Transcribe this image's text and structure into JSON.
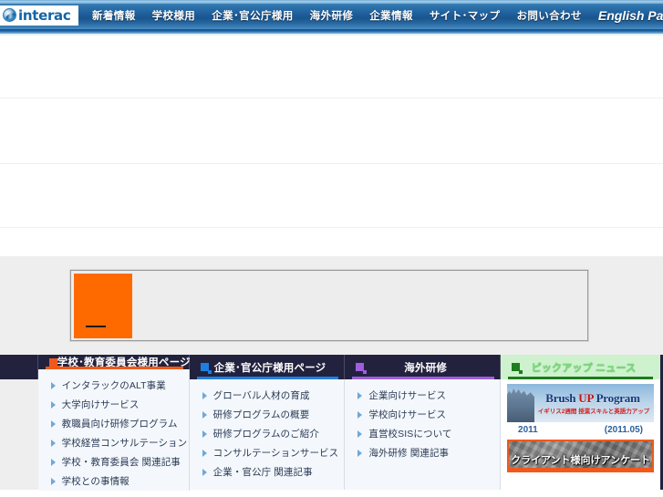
{
  "brand": {
    "logo_text": "interac",
    "logo_icon": "swirl-globe-icon"
  },
  "nav": {
    "items": [
      {
        "label": "新着情報",
        "name": "nav-news"
      },
      {
        "label": "学校様用",
        "name": "nav-schools"
      },
      {
        "label": "企業･官公庁様用",
        "name": "nav-corporate"
      },
      {
        "label": "海外研修",
        "name": "nav-overseas-training"
      },
      {
        "label": "企業情報",
        "name": "nav-company-info"
      },
      {
        "label": "サイト･マップ",
        "name": "nav-sitemap"
      },
      {
        "label": "お問い合わせ",
        "name": "nav-contact"
      },
      {
        "label": "English Page",
        "name": "nav-english-page"
      }
    ]
  },
  "banner": {
    "placeholder_color": "#ff6a00",
    "frame_name": "main-banner-frame"
  },
  "footer": {
    "columns": [
      {
        "title": "学校･教育委員会様用ページ",
        "accent": "#f0591b",
        "icon": "orange-square-icon",
        "links": [
          "インタラックのALT事業",
          "大学向けサービス",
          "教職員向け研修プログラム",
          "学校経営コンサルテーション",
          "学校・教育委員会 関連記事",
          "学校との事情報"
        ]
      },
      {
        "title": "企業･官公庁様用ページ",
        "accent": "#1d7fe0",
        "icon": "blue-square-icon",
        "links": [
          "グローバル人材の育成",
          "研修プログラムの概要",
          "研修プログラムのご紹介",
          "コンサルテーションサービス",
          "企業・官公庁 関連記事"
        ]
      },
      {
        "title": "海外研修",
        "accent": "#a05edc",
        "icon": "purple-square-icon",
        "links": [
          "企業向けサービス",
          "学校向けサービス",
          "直営校SISについて",
          "海外研修 関連記事"
        ]
      }
    ],
    "pickup": {
      "title": "ピックアップ ニュース",
      "accent": "#1e7d1e",
      "icon": "green-square-icon",
      "promo": {
        "title_pre": "Brush ",
        "title_up": "UP",
        "title_post": " Program",
        "subtitle": "イギリス2週間 授業スキルと英語力アップ",
        "year": "2011",
        "date": "(2011.05)"
      },
      "survey": {
        "label": "クライアント様向けアンケート"
      }
    }
  }
}
